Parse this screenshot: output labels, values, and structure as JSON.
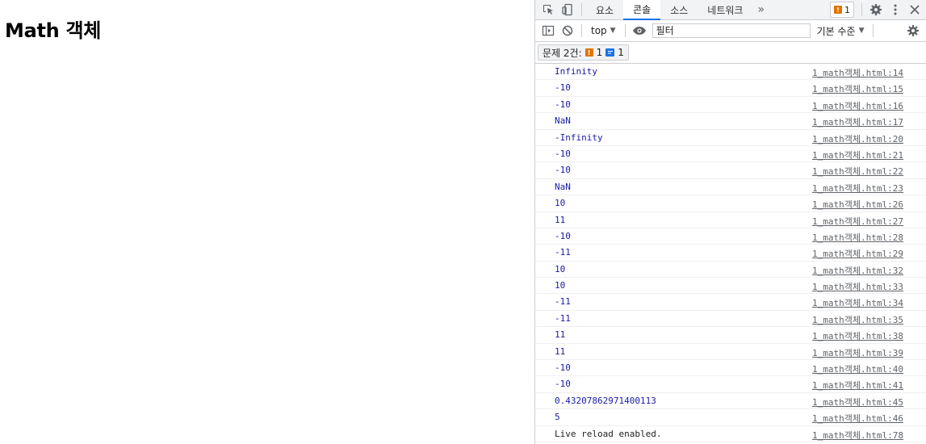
{
  "page": {
    "heading": "Math 객체"
  },
  "devtools": {
    "tabs": [
      {
        "label": "요소",
        "active": false
      },
      {
        "label": "콘솔",
        "active": true
      },
      {
        "label": "소스",
        "active": false
      },
      {
        "label": "네트워크",
        "active": false
      }
    ],
    "more_tabs": "»",
    "issues_badge_count": "1",
    "toolbar": {
      "context": "top",
      "filter_placeholder": "필터",
      "levels": "기본 수준"
    },
    "issues": {
      "label": "문제 2건:",
      "warn_count": "1",
      "info_count": "1"
    },
    "colors": {
      "accent": "#1a73e8",
      "warning": "#e37400",
      "value_text": "#1a1aa6"
    },
    "logs": [
      {
        "msg": "Infinity",
        "src": "1_math객체.html:14"
      },
      {
        "msg": "-10",
        "src": "1_math객체.html:15"
      },
      {
        "msg": "-10",
        "src": "1_math객체.html:16"
      },
      {
        "msg": "NaN",
        "src": "1_math객체.html:17"
      },
      {
        "msg": "-Infinity",
        "src": "1_math객체.html:20"
      },
      {
        "msg": "-10",
        "src": "1_math객체.html:21"
      },
      {
        "msg": "-10",
        "src": "1_math객체.html:22"
      },
      {
        "msg": "NaN",
        "src": "1_math객체.html:23"
      },
      {
        "msg": "10",
        "src": "1_math객체.html:26"
      },
      {
        "msg": "11",
        "src": "1_math객체.html:27"
      },
      {
        "msg": "-10",
        "src": "1_math객체.html:28"
      },
      {
        "msg": "-11",
        "src": "1_math객체.html:29"
      },
      {
        "msg": "10",
        "src": "1_math객체.html:32"
      },
      {
        "msg": "10",
        "src": "1_math객체.html:33"
      },
      {
        "msg": "-11",
        "src": "1_math객체.html:34"
      },
      {
        "msg": "-11",
        "src": "1_math객체.html:35"
      },
      {
        "msg": "11",
        "src": "1_math객체.html:38"
      },
      {
        "msg": "11",
        "src": "1_math객체.html:39"
      },
      {
        "msg": "-10",
        "src": "1_math객체.html:40"
      },
      {
        "msg": "-10",
        "src": "1_math객체.html:41"
      },
      {
        "msg": "0.43207862971400113",
        "src": "1_math객체.html:45"
      },
      {
        "msg": "5",
        "src": "1_math객체.html:46"
      },
      {
        "msg": "Live reload enabled.",
        "src": "1_math객체.html:78"
      }
    ]
  }
}
